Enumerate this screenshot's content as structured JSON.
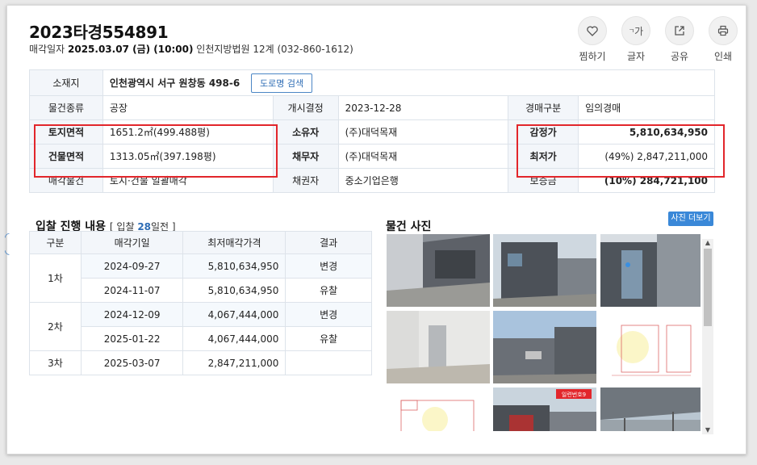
{
  "header": {
    "case_no": "2023타경554891",
    "sale_date_label": "매각일자",
    "sale_date": "2025.03.07 (금) (10:00)",
    "court": "인천지방법원 12계 (032-860-1612)"
  },
  "actions": [
    {
      "label": "찜하기",
      "icon": "heart-icon"
    },
    {
      "label": "글자",
      "icon": "font-size-icon",
      "glyph": "가"
    },
    {
      "label": "공유",
      "icon": "share-icon"
    },
    {
      "label": "인쇄",
      "icon": "print-icon"
    }
  ],
  "info": {
    "location_label": "소재지",
    "location": "인천광역시 서구 원창동 498-6",
    "road_button": "도로명 검색",
    "type_label": "물건종류",
    "type": "공장",
    "start_label": "개시결정",
    "start": "2023-12-28",
    "auction_label": "경매구분",
    "auction": "임의경매",
    "land_label": "토지면적",
    "land": "1651.2㎡(499.488평)",
    "owner_label": "소유자",
    "owner": "(주)대덕목재",
    "appraisal_label": "감정가",
    "appraisal": "5,810,634,950",
    "building_label": "건물면적",
    "building": "1313.05㎡(397.198평)",
    "debtor_label": "채무자",
    "debtor": "(주)대덕목재",
    "min_label": "최저가",
    "min": "(49%) 2,847,211,000",
    "sale_item_label": "매각물건",
    "sale_item": "토지·건물 일괄매각",
    "creditor_label": "채권자",
    "creditor": "중소기업은행",
    "deposit_label": "보증금",
    "deposit": "(10%) 284,721,100"
  },
  "bids": {
    "title": "입찰 진행 내용",
    "sub_prefix": "[ 입찰 ",
    "sub_days": "28",
    "sub_suffix": "일전 ]",
    "headers": [
      "구분",
      "매각기일",
      "최저매각가격",
      "결과"
    ],
    "rows": [
      {
        "round": "",
        "date": "2024-09-27",
        "price": "5,810,634,950",
        "result": "변경"
      },
      {
        "round": "1차",
        "date": "2024-11-07",
        "price": "5,810,634,950",
        "result": "유찰"
      },
      {
        "round": "",
        "date": "2024-12-09",
        "price": "4,067,444,000",
        "result": "변경"
      },
      {
        "round": "2차",
        "date": "2025-01-22",
        "price": "4,067,444,000",
        "result": "유찰"
      },
      {
        "round": "3차",
        "date": "2025-03-07",
        "price": "2,847,211,000",
        "result": ""
      }
    ]
  },
  "photos": {
    "title": "물건 사진",
    "more_button": "사진 더보기",
    "stamp_text": "일련번호9"
  }
}
